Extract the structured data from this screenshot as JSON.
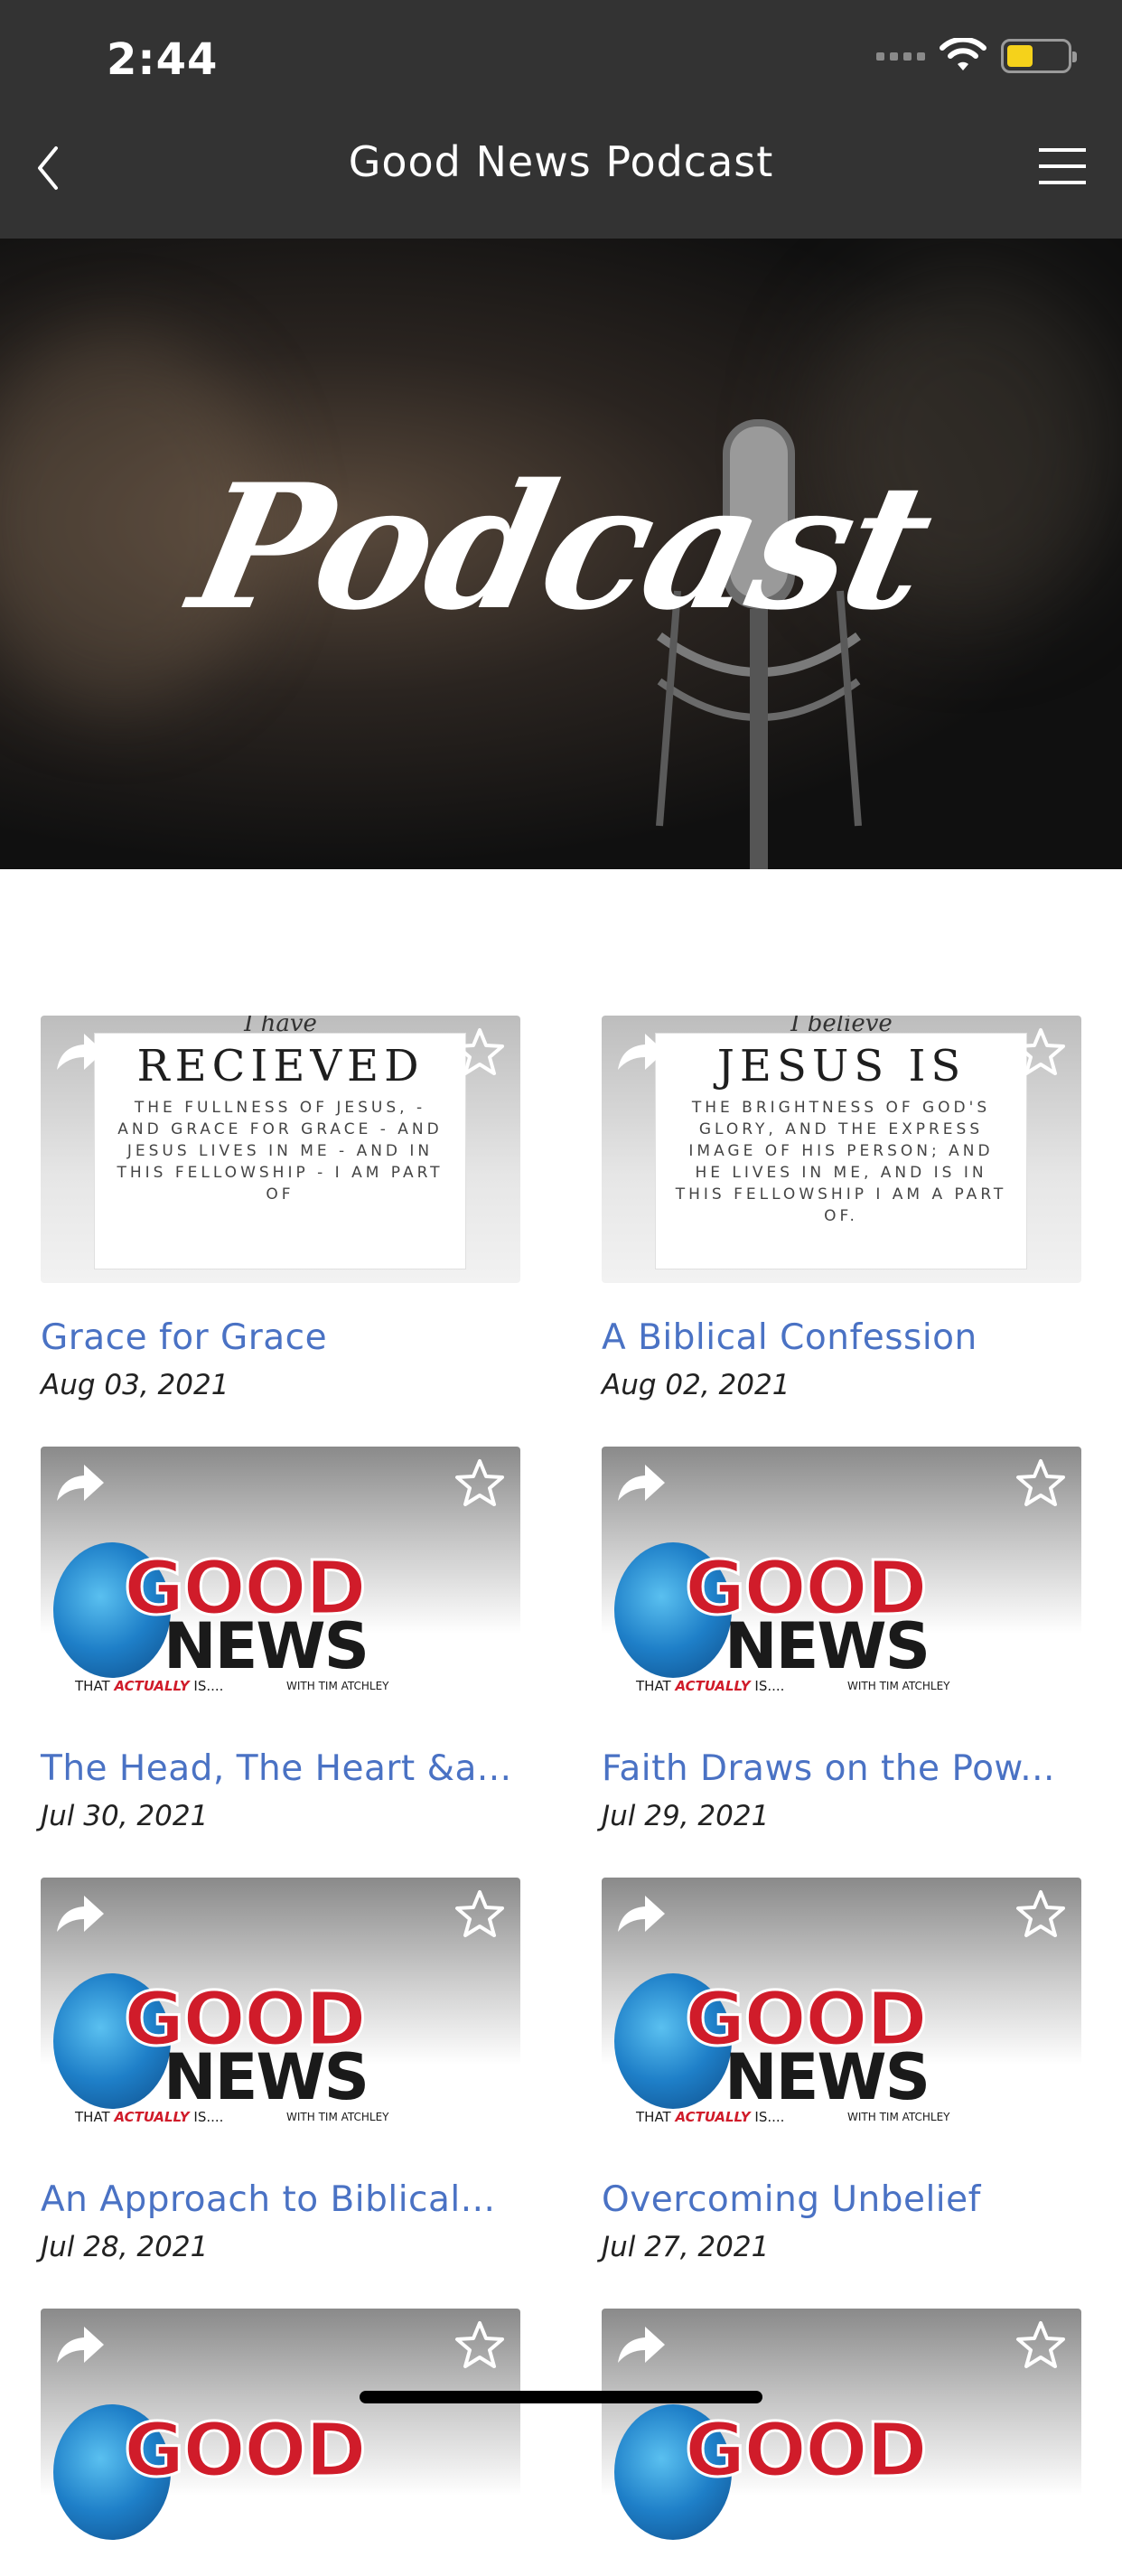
{
  "status": {
    "time": "2:44"
  },
  "nav": {
    "title": "Good News Podcast"
  },
  "hero": {
    "title": "Podcast"
  },
  "logo": {
    "good": "GOOD",
    "news": "NEWS",
    "tag_prefix": "THAT ",
    "tag_emph": "ACTUALLY",
    "tag_suffix": " IS....",
    "with": "WITH TIM ATCHLEY"
  },
  "episodes": [
    {
      "title": "Grace for Grace",
      "date": "Aug 03, 2021",
      "thumb": {
        "small": "I have",
        "big": "RECIEVED",
        "body": "THE FULLNESS OF JESUS, - AND GRACE FOR GRACE - AND JESUS LIVES IN ME - AND IN THIS FELLOWSHIP - I AM PART OF"
      }
    },
    {
      "title": "A Biblical Confession",
      "date": "Aug 02, 2021",
      "thumb": {
        "small": "I believe",
        "big": "JESUS IS",
        "body": "THE BRIGHTNESS OF GOD'S GLORY, AND THE EXPRESS IMAGE OF HIS PERSON; AND HE LIVES IN ME, AND IS IN THIS FELLOWSHIP I AM A PART OF."
      }
    },
    {
      "title": "The Head, The Heart &a...",
      "date": "Jul 30, 2021"
    },
    {
      "title": "Faith Draws on the Pow...",
      "date": "Jul 29, 2021"
    },
    {
      "title": "An Approach to Biblical...",
      "date": "Jul 28, 2021"
    },
    {
      "title": "Overcoming Unbelief",
      "date": "Jul 27, 2021"
    }
  ],
  "icons": {
    "share": "share-arrow-icon",
    "favorite": "star-outline-icon",
    "back": "chevron-left-icon",
    "menu": "hamburger-menu-icon"
  },
  "colors": {
    "topbar": "#333333",
    "link": "#4a72c4",
    "battery": "#f5d21b"
  }
}
